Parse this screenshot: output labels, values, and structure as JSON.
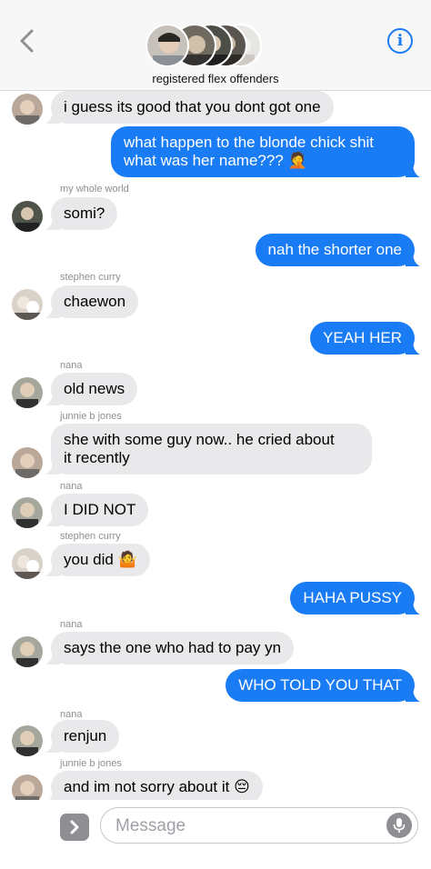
{
  "header": {
    "group_name": "registered flex offenders",
    "info_glyph": "i"
  },
  "messages": [
    {
      "side": "in",
      "text": "i guess its good that you dont got one"
    },
    {
      "side": "out",
      "text": "what happen to the blonde chick shit",
      "text2": "what was her name???",
      "emoji": "🤦"
    },
    {
      "side": "in",
      "sender": "my whole world",
      "text": "somi?"
    },
    {
      "side": "out",
      "text": "nah the shorter one"
    },
    {
      "side": "in",
      "sender": "stephen curry",
      "text": "chaewon"
    },
    {
      "side": "out",
      "text": "YEAH HER"
    },
    {
      "side": "in",
      "sender": "nana",
      "text": "old news"
    },
    {
      "side": "in",
      "sender": "junnie b jones",
      "text": "she with some guy now.. he cried about",
      "text2": "it recently"
    },
    {
      "side": "in",
      "sender": "nana",
      "text": "I DID NOT"
    },
    {
      "side": "in",
      "sender": "stephen curry",
      "text": "you did",
      "emoji": "🤷"
    },
    {
      "side": "out",
      "text": "HAHA PUSSY"
    },
    {
      "side": "in",
      "sender": "nana",
      "text": "says the one who had to pay yn"
    },
    {
      "side": "out",
      "text": "WHO TOLD YOU THAT"
    },
    {
      "side": "in",
      "sender": "nana",
      "text": "renjun"
    },
    {
      "side": "in",
      "sender": "junnie b jones",
      "text": "and im not sorry about it",
      "emoji": "😔"
    }
  ],
  "composer": {
    "placeholder": "Message"
  },
  "colors": {
    "accent": "#1a7cf5",
    "incoming_bubble": "#e9e9eb",
    "sender_label": "#8e8e93"
  },
  "icons": [
    "chevron-left-icon",
    "info-icon",
    "app-store-icon",
    "microphone-icon"
  ]
}
